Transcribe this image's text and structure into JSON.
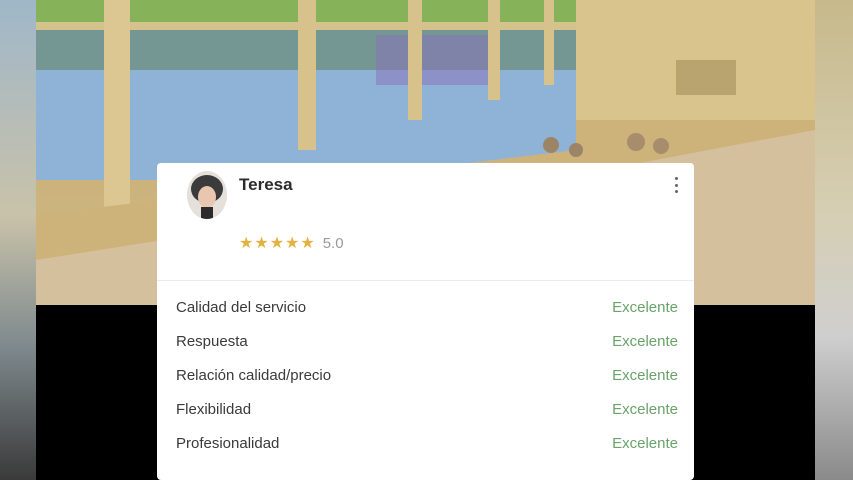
{
  "review": {
    "reviewer_name": "Teresa",
    "rating_value": "5.0",
    "stars_filled": 5,
    "stars_total": 5,
    "star_color": "#e3b341",
    "criteria": [
      {
        "label": "Calidad del servicio",
        "value": "Excelente"
      },
      {
        "label": "Respuesta",
        "value": "Excelente"
      },
      {
        "label": "Relación calidad/precio",
        "value": "Excelente"
      },
      {
        "label": "Flexibilidad",
        "value": "Excelente"
      },
      {
        "label": "Profesionalidad",
        "value": "Excelente"
      }
    ],
    "value_color": "#6aa26a",
    "menu_icon": "more-vertical-icon"
  },
  "background": {
    "photo_subject": "venue-hall-photo"
  }
}
